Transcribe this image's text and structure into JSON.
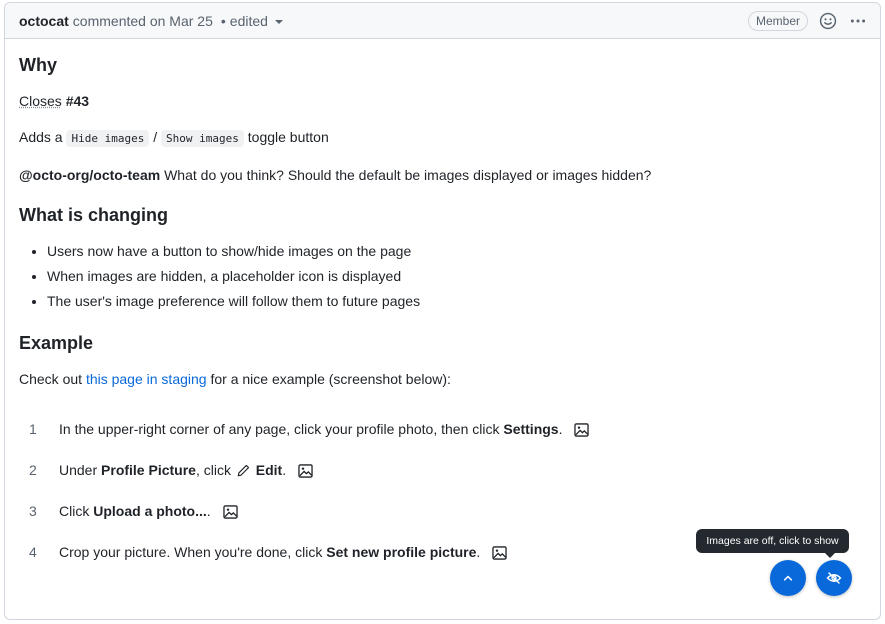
{
  "header": {
    "author": "octocat",
    "commented": "commented on Mar 25",
    "dot": "•",
    "edited": "edited",
    "badge": "Member"
  },
  "body": {
    "why_heading": "Why",
    "closes_link": "Closes",
    "issue_number": "#43",
    "adds_prefix": "Adds a",
    "code_hide": "Hide images",
    "slash": "/",
    "code_show": "Show images",
    "adds_suffix": "toggle button",
    "mention": "@octo-org/octo-team",
    "question": "What do you think? Should the default be images displayed or images hidden?",
    "changing_heading": "What is changing",
    "bullets": [
      "Users now have a button to show/hide images on the page",
      "When images are hidden, a placeholder icon is displayed",
      "The user's image preference will follow them to future pages"
    ],
    "example_heading": "Example",
    "checkout_prefix": "Check out",
    "staging_link": "this page in staging",
    "checkout_suffix": "for a nice example (screenshot below):"
  },
  "steps": [
    {
      "num": "1",
      "pre": "In the upper-right corner of any page, click your profile photo, then click",
      "bold": "Settings",
      "post": "."
    },
    {
      "num": "2",
      "pre": "Under",
      "bold": "Profile Picture",
      "mid": ", click",
      "bold2": "Edit",
      "post": "."
    },
    {
      "num": "3",
      "pre": "Click",
      "bold": "Upload a photo...",
      "post": "."
    },
    {
      "num": "4",
      "pre": "Crop your picture. When you're done, click",
      "bold": "Set new profile picture",
      "post": "."
    }
  ],
  "floating": {
    "tooltip": "Images are off, click to show"
  },
  "icons": [
    "chevron-down-icon",
    "smiley-icon",
    "kebab-icon",
    "image-icon",
    "pencil-icon",
    "arrow-up-icon",
    "eye-closed-icon"
  ],
  "colors": {
    "accent": "#0969da",
    "border": "#d0d7de",
    "header_bg": "#f6f8fa",
    "tooltip_bg": "#24292f"
  }
}
